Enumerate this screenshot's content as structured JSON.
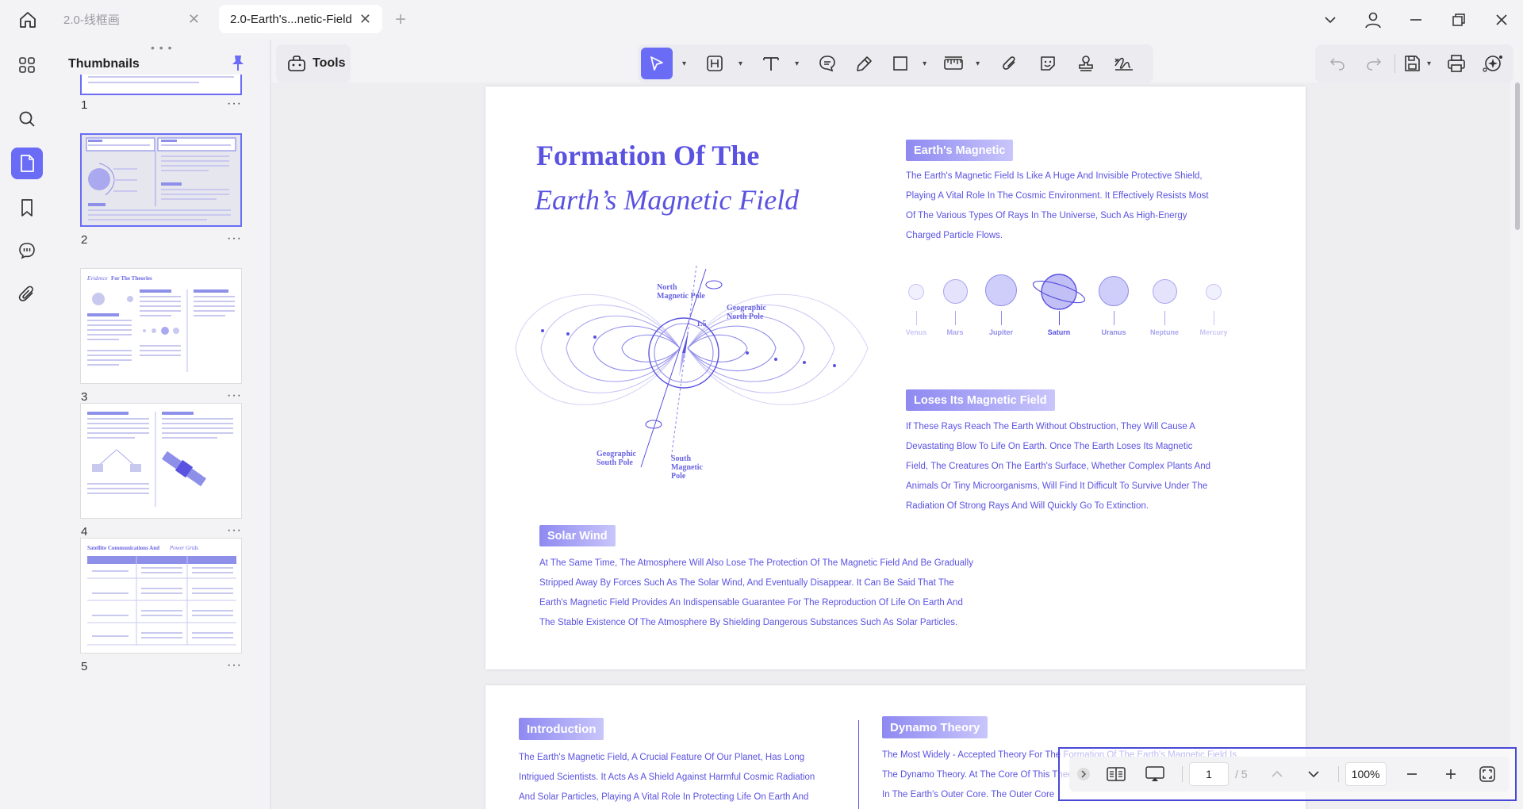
{
  "tabs": [
    {
      "label": "2.0-线框画",
      "active": false
    },
    {
      "label": "2.0-Earth's...netic-Field",
      "active": true
    }
  ],
  "thumbnails": {
    "header": "Thumbnails",
    "pages": [
      {
        "num": "1"
      },
      {
        "num": "2"
      },
      {
        "num": "3"
      },
      {
        "num": "4"
      },
      {
        "num": "5"
      }
    ]
  },
  "toolbar": {
    "tools_label": "Tools"
  },
  "page1": {
    "title_line1": "Formation Of The",
    "title_line2": "Earth’s Magnetic Field",
    "diagram": {
      "north_magnetic_pole": "North\nMagnetic Pole",
      "geographic_north_pole": "Geographic\nNorth Pole",
      "angle": "1.5",
      "geographic_south_pole": "Geographic\nSouth Pole",
      "south_magnetic_pole": "South\nMagnetic\nPole"
    },
    "earths_magnetic": {
      "heading": "Earth's Magnetic",
      "lines": [
        "The Earth's Magnetic Field Is Like A Huge And Invisible Protective Shield,",
        "Playing A Vital Role In The Cosmic Environment. It Effectively Resists Most",
        "Of The Various Types Of Rays In The Universe, Such As High-Energy",
        "Charged Particle Flows."
      ]
    },
    "planets": [
      "Venus",
      "Mars",
      "Jupiter",
      "Saturn",
      "Uranus",
      "Neptune",
      "Mercury"
    ],
    "loses": {
      "heading": "Loses Its Magnetic Field",
      "lines": [
        "If These Rays Reach The Earth Without Obstruction, They Will Cause A",
        "Devastating Blow To Life On Earth. Once The Earth Loses Its Magnetic",
        "Field, The Creatures On The Earth's Surface, Whether Complex Plants And",
        "Animals Or Tiny Microorganisms, Will Find It Difficult To Survive Under The",
        "Radiation Of Strong Rays And Will Quickly Go To Extinction."
      ]
    },
    "solar_wind": {
      "heading": "Solar Wind",
      "lines": [
        "At The Same Time, The Atmosphere Will Also Lose The Protection Of The Magnetic Field And Be Gradually",
        "Stripped Away By Forces Such As The Solar Wind, And Eventually Disappear. It Can Be Said That The",
        "Earth's Magnetic Field Provides An Indispensable Guarantee For The Reproduction Of Life On Earth And",
        "The Stable Existence Of The Atmosphere By Shielding Dangerous Substances Such As Solar Particles."
      ]
    }
  },
  "page2": {
    "introduction": {
      "heading": "Introduction",
      "lines": [
        "The Earth's Magnetic Field, A Crucial Feature Of Our Planet, Has Long",
        "Intrigued Scientists. It Acts As A Shield Against Harmful Cosmic Radiation",
        "And Solar Particles, Playing A Vital Role In Protecting Life On Earth And"
      ]
    },
    "dynamo": {
      "heading": "Dynamo Theory",
      "lines": [
        "The Most Widely - Accepted Theory For The Formation Of The Earth's Magnetic Field Is",
        "The Dynamo Theory. At The Core Of This Theory",
        "In The Earth's Outer Core. The Outer Core"
      ]
    }
  },
  "bottom_bar": {
    "current_page": "1",
    "total_pages": "/ 5",
    "zoom": "100%"
  },
  "colors": {
    "accent": "#6a6cf6",
    "doc_text": "#5a52e0"
  }
}
